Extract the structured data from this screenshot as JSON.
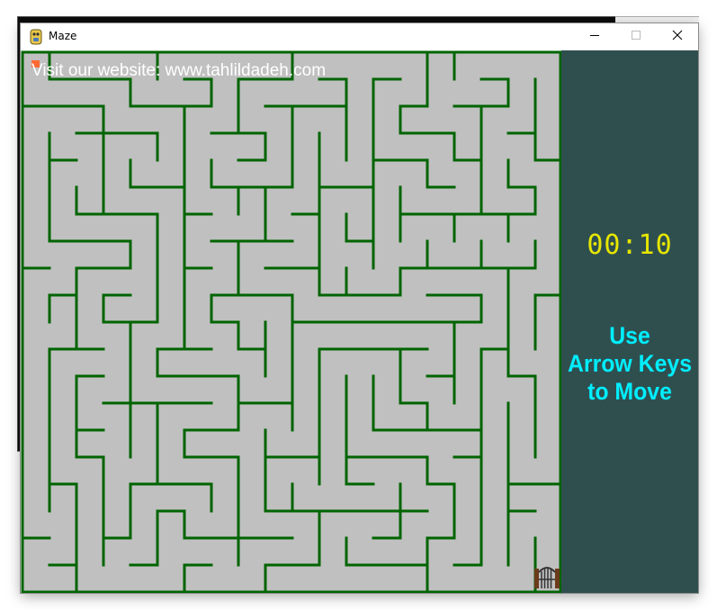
{
  "window": {
    "title": "Maze",
    "controls": {
      "minimize": "minimize-icon",
      "maximize": "maximize-icon",
      "close": "close-icon"
    }
  },
  "overlay": {
    "website": "Visit our website: www.tahlildadeh.com"
  },
  "panel": {
    "timer": "00:10",
    "instructions": [
      "Use",
      "Arrow Keys",
      "to Move"
    ]
  },
  "maze": {
    "cols": 20,
    "rows": 20,
    "player_icon": "player-marker-icon",
    "exit_icon": "gate-icon"
  },
  "colors": {
    "maze_floor": "#c0c0c0",
    "maze_wall": "#006400",
    "panel_bg": "#2f4f4f",
    "timer": "#e6e600",
    "instructions": "#00eeff",
    "player": "#ff6a33"
  }
}
